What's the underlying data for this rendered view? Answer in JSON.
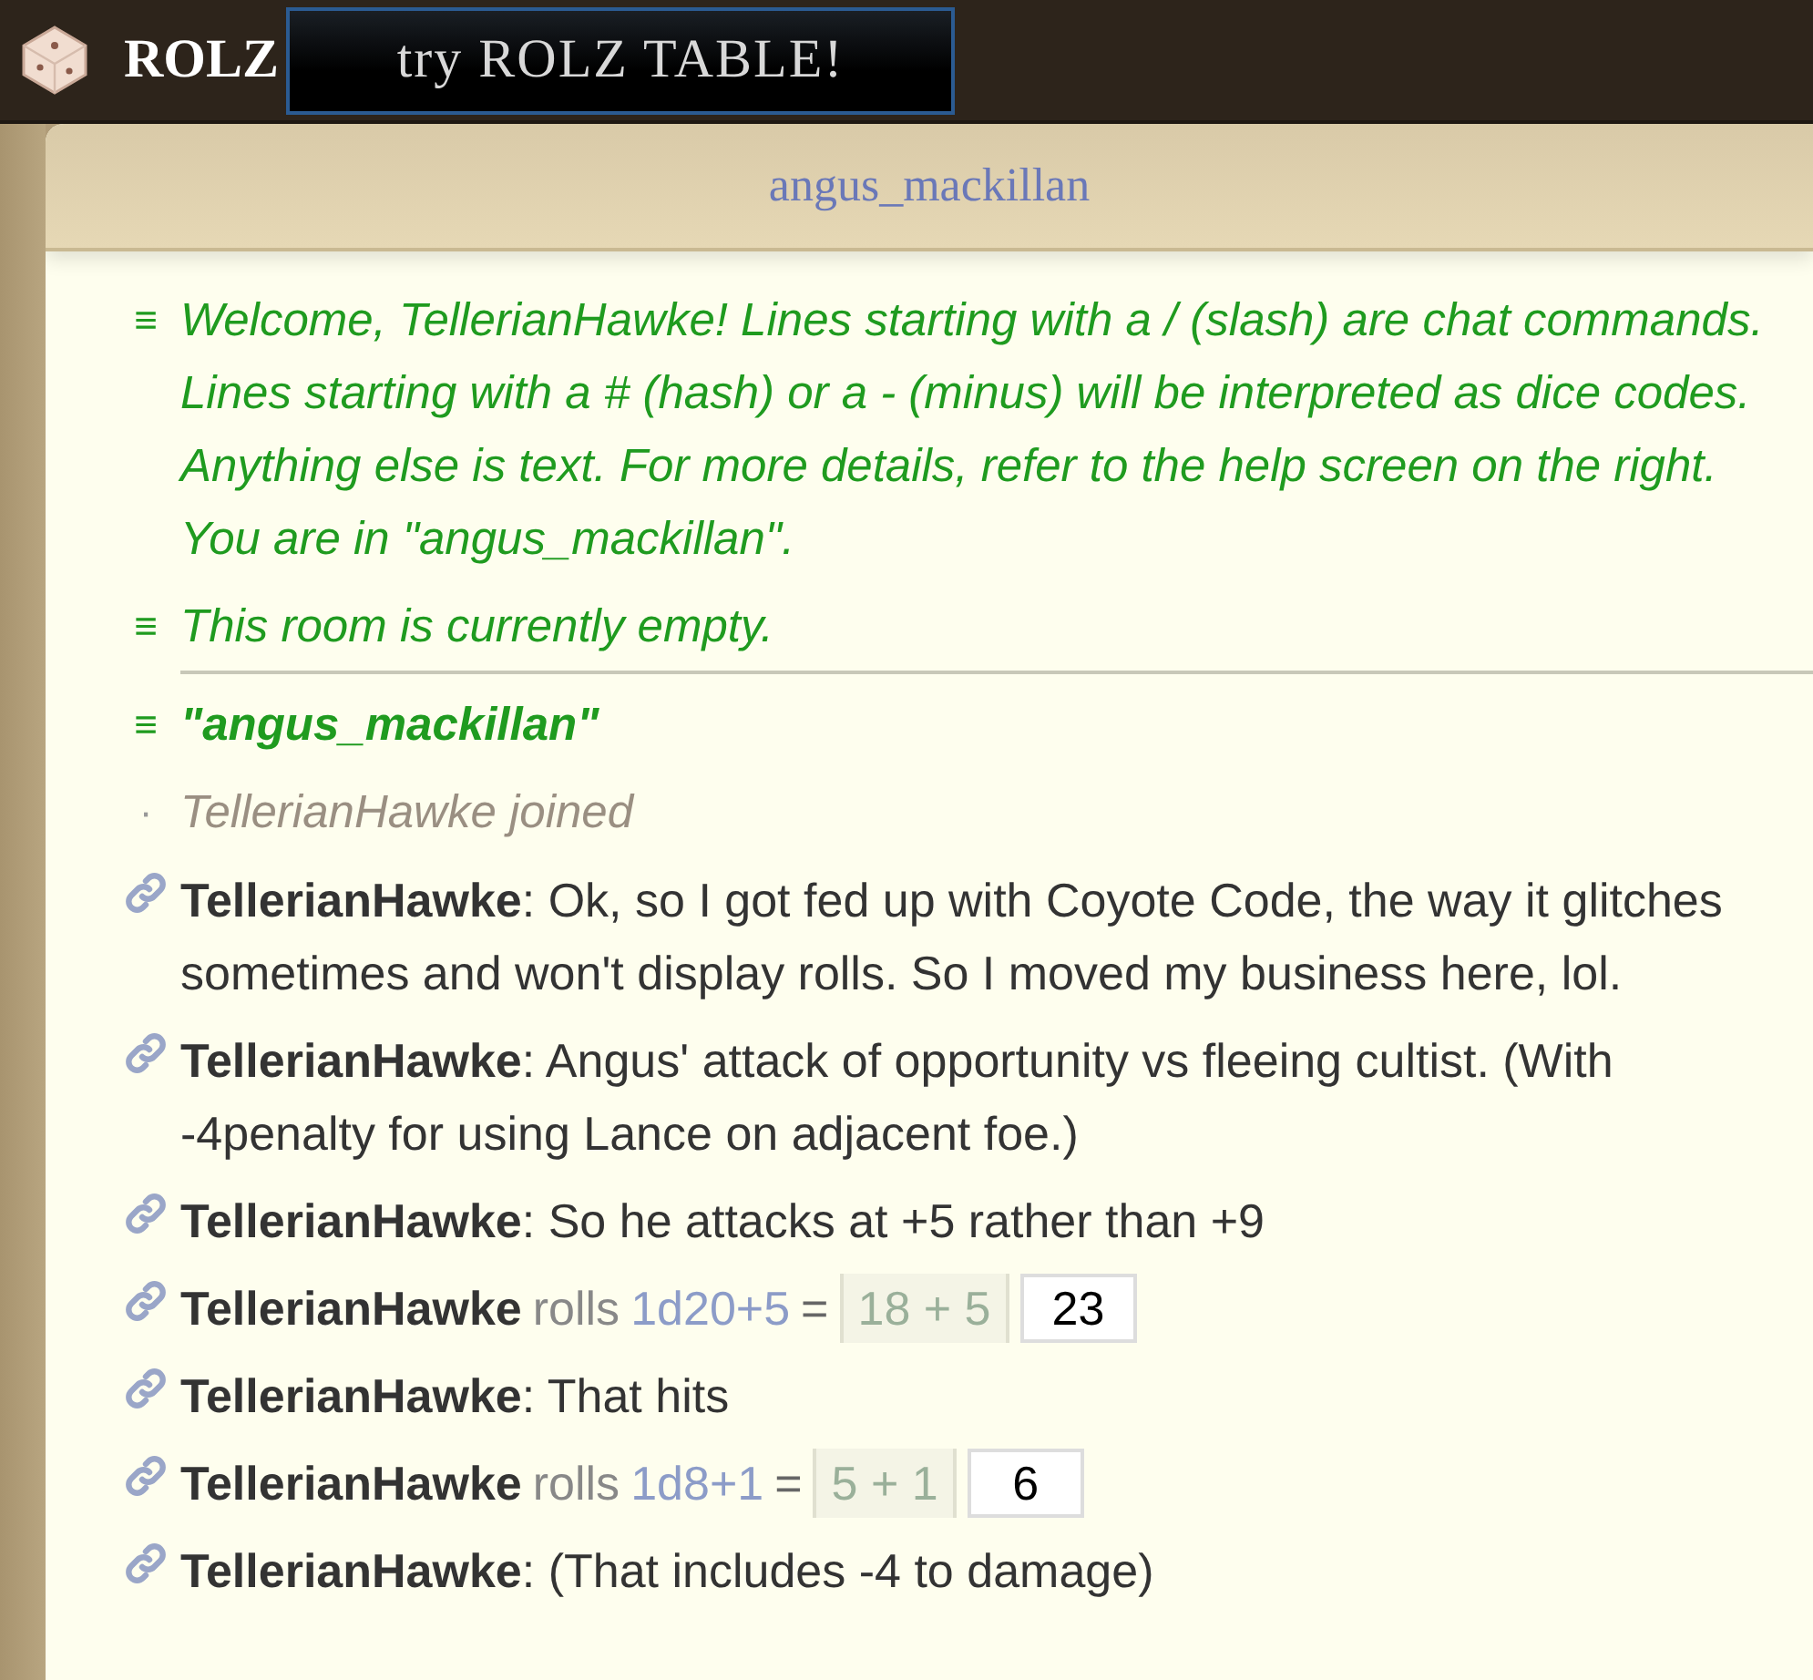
{
  "topbar": {
    "brand": "ROLZ",
    "promo_button": "try ROLZ TABLE!"
  },
  "room": {
    "title": "angus_mackillan"
  },
  "messages": [
    {
      "kind": "system",
      "icon": "≡",
      "text": "Welcome, TellerianHawke! Lines starting with a / (slash) are chat commands. Lines starting with a # (hash) or a - (minus) will be interpreted as dice codes. Anything else is text. For more details, refer to the help screen on the right. You are in \"angus_mackillan\"."
    },
    {
      "kind": "system",
      "icon": "≡",
      "text": "This room is currently empty.",
      "divider_after": true
    },
    {
      "kind": "room",
      "icon": "≡",
      "text": "\"angus_mackillan\""
    },
    {
      "kind": "join",
      "icon": "·",
      "text": "TellerianHawke joined"
    },
    {
      "kind": "chat",
      "user": "TellerianHawke",
      "text": ": Ok, so I got fed up with Coyote Code, the way it glitches sometimes and won't display rolls. So I moved my business here, lol."
    },
    {
      "kind": "chat",
      "user": "TellerianHawke",
      "text": ": Angus' attack of opportunity vs fleeing cultist. (With -4penalty for using Lance on adjacent foe.)"
    },
    {
      "kind": "chat",
      "user": "TellerianHawke",
      "text": ": So he attacks at +5 rather than +9"
    },
    {
      "kind": "roll",
      "user": "TellerianHawke",
      "verb": "rolls",
      "code": "1d20+5",
      "equals": "=",
      "breakdown": "18 + 5",
      "total": "23"
    },
    {
      "kind": "chat",
      "user": "TellerianHawke",
      "text": ": That hits"
    },
    {
      "kind": "roll",
      "user": "TellerianHawke",
      "verb": "rolls",
      "code": "1d8+1",
      "equals": "=",
      "breakdown": "5 + 1",
      "total": "6"
    },
    {
      "kind": "chat",
      "user": "TellerianHawke",
      "text": ": (That includes -4 to damage)"
    }
  ]
}
